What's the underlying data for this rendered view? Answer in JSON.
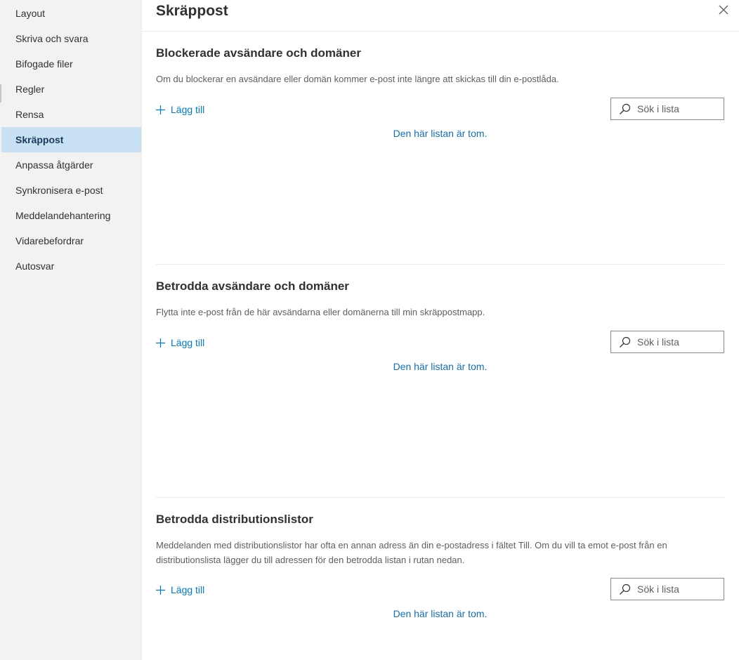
{
  "sidebar": {
    "items": [
      {
        "label": "Layout"
      },
      {
        "label": "Skriva och svara"
      },
      {
        "label": "Bifogade filer"
      },
      {
        "label": "Regler"
      },
      {
        "label": "Rensa"
      },
      {
        "label": "Skräppost",
        "selected": true
      },
      {
        "label": "Anpassa åtgärder"
      },
      {
        "label": "Synkronisera e-post"
      },
      {
        "label": "Meddelandehantering"
      },
      {
        "label": "Vidarebefordrar"
      },
      {
        "label": "Autosvar"
      }
    ]
  },
  "main": {
    "title": "Skräppost",
    "close_icon": "close-icon",
    "sections": [
      {
        "title": "Blockerade avsändare och domäner",
        "description": "Om du blockerar en avsändare eller domän kommer e-post inte längre att skickas till din e-postlåda.",
        "add_label": "Lägg till",
        "search_placeholder": "Sök i lista",
        "empty_text": "Den här listan är tom."
      },
      {
        "title": "Betrodda avsändare och domäner",
        "description": "Flytta inte e-post från de här avsändarna eller domänerna till min skräppostmapp.",
        "add_label": "Lägg till",
        "search_placeholder": "Sök i lista",
        "empty_text": "Den här listan är tom."
      },
      {
        "title": "Betrodda distributionslistor",
        "description": "Meddelanden med distributionslistor har ofta en annan adress än din e-postadress i fältet Till. Om du vill ta emot e-post från en distributionslista lägger du till adressen för den betrodda listan i rutan nedan.",
        "add_label": "Lägg till",
        "search_placeholder": "Sök i lista",
        "empty_text": "Den här listan är tom."
      }
    ]
  },
  "colors": {
    "accent": "#0078d4",
    "link": "#106ebe",
    "selected_nav_bg": "#c7e0f4",
    "sidebar_bg": "#f3f2f1"
  }
}
